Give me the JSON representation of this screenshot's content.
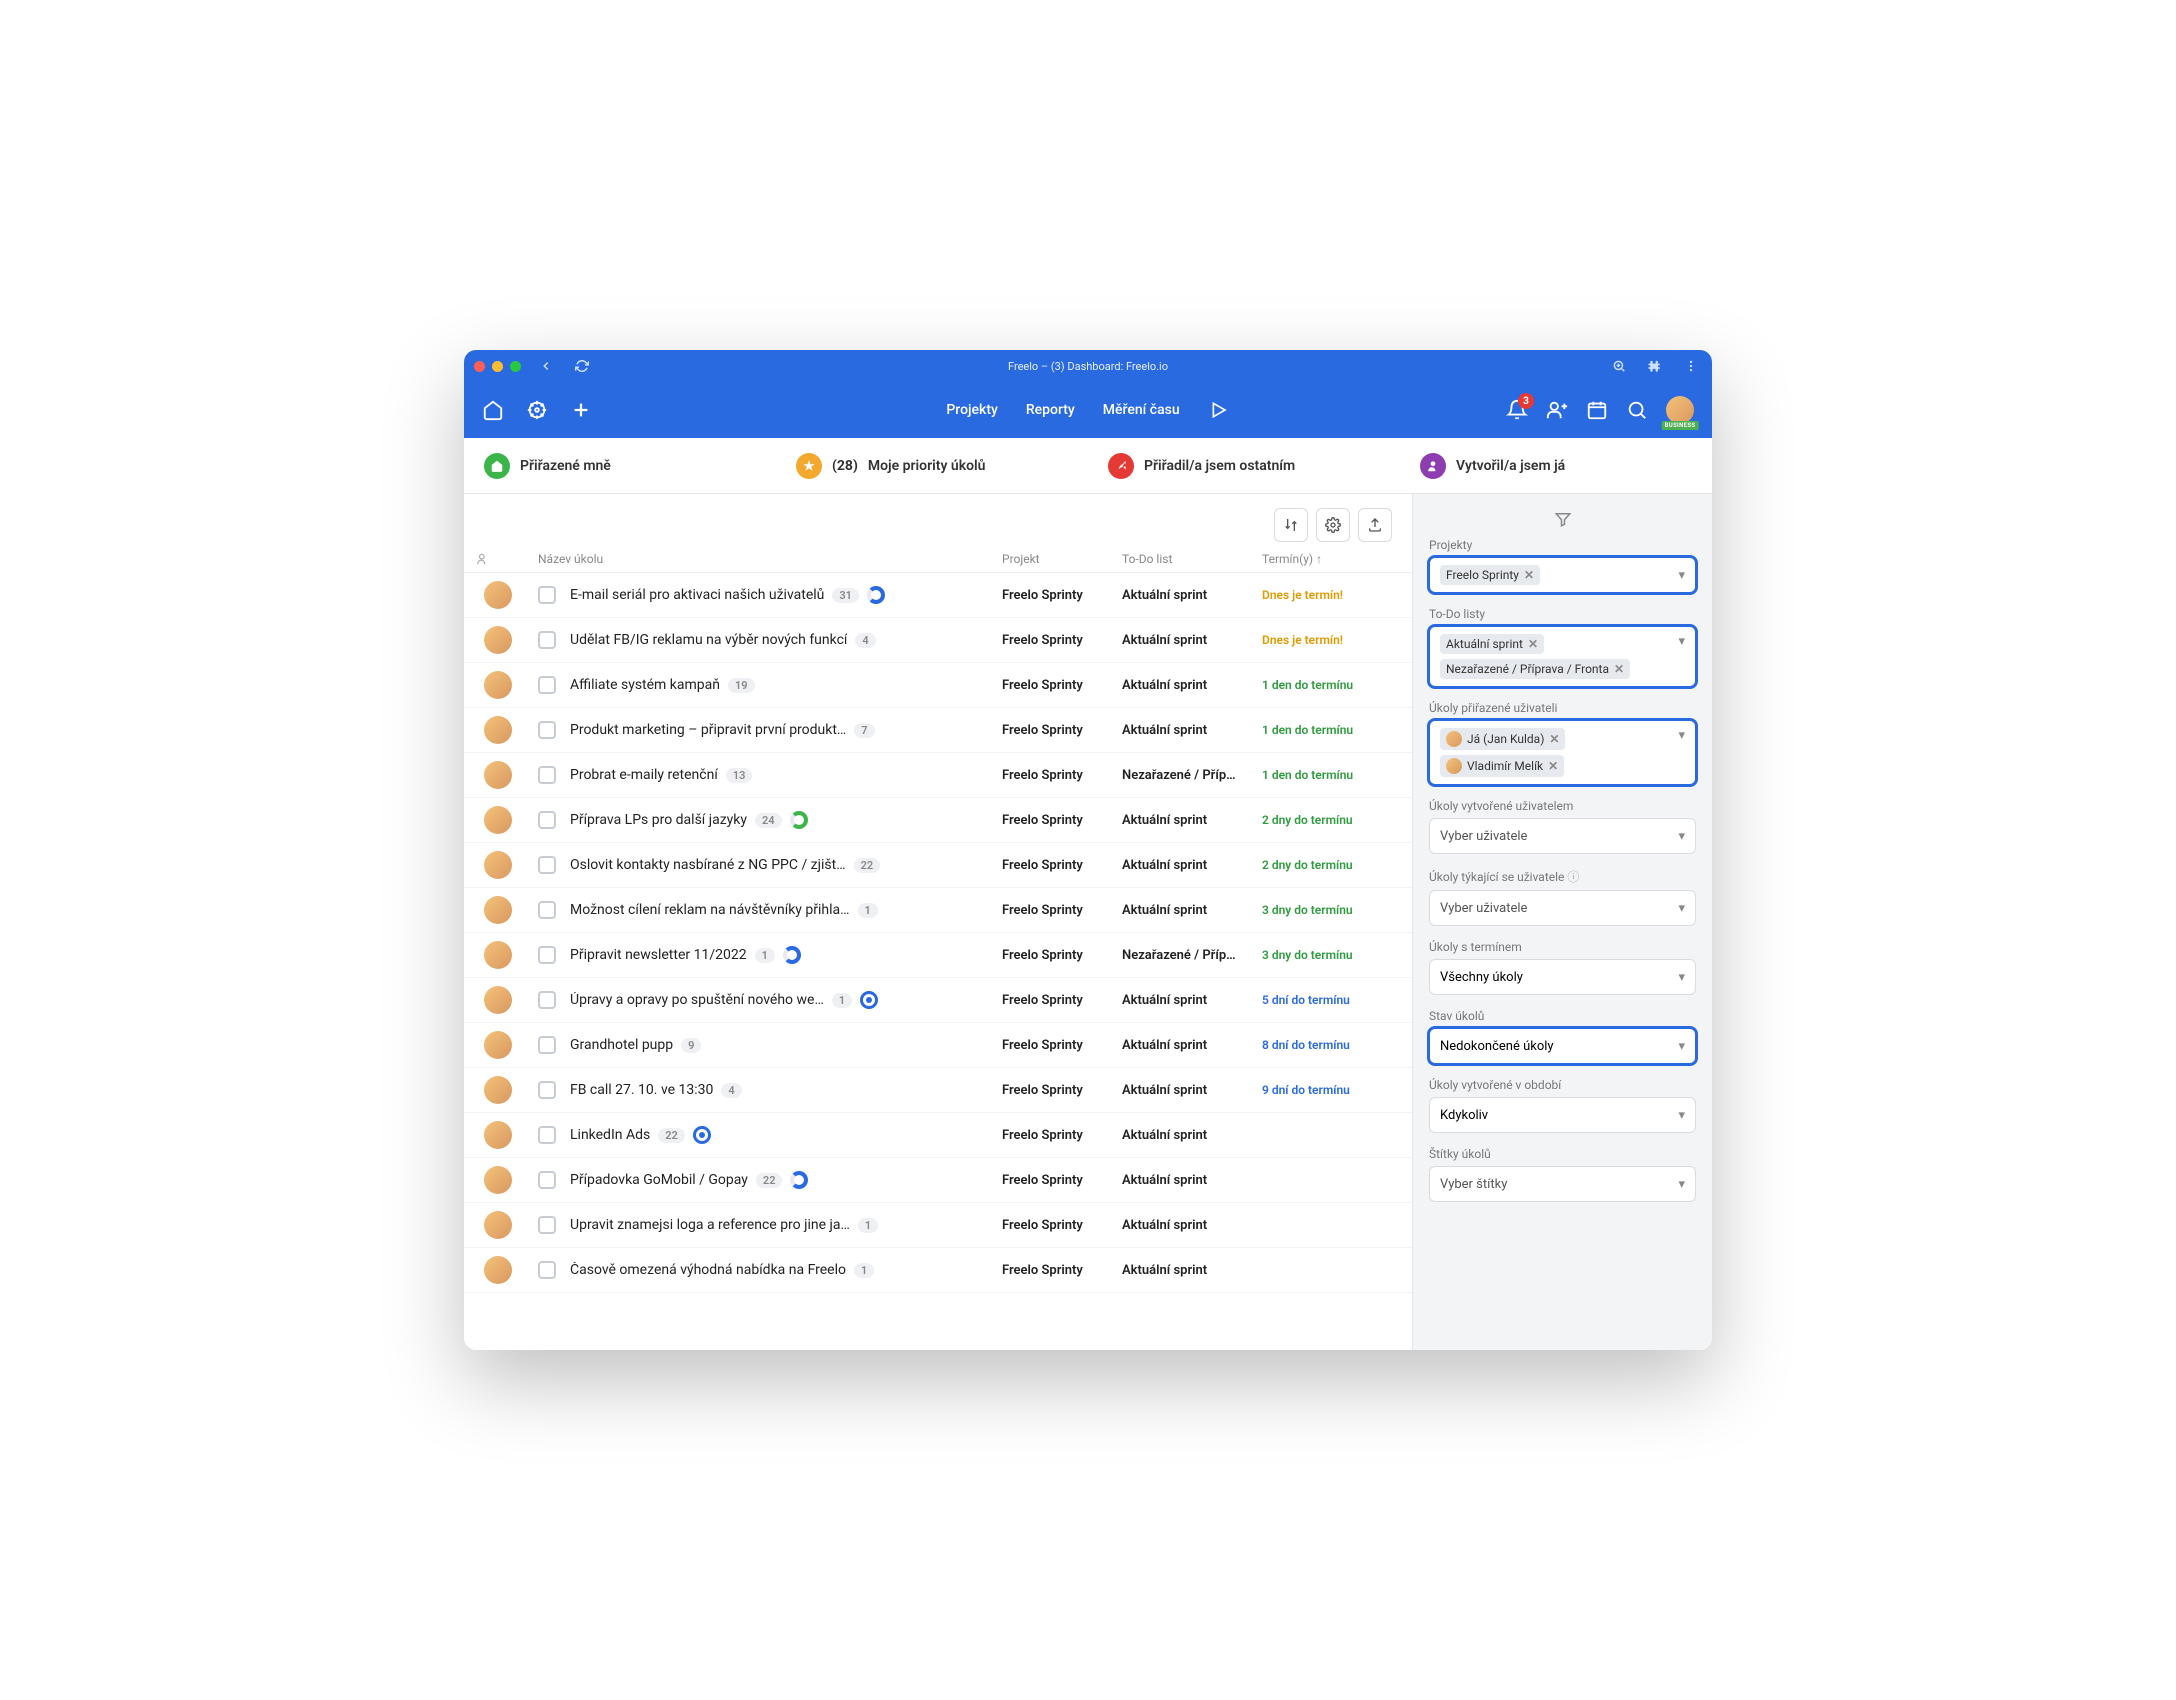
{
  "window_title": "Freelo – (3) Dashboard: Freelo.io",
  "notif_count": "3",
  "avatar_badge": "BUSINESS",
  "nav": {
    "projekty": "Projekty",
    "reporty": "Reporty",
    "mereni": "Měření času"
  },
  "tabs": {
    "assigned": "Přiřazené mně",
    "priority_count": "(28)",
    "priority": "Moje priority úkolů",
    "delegated": "Přiřadil/a jsem ostatním",
    "created": "Vytvořil/a jsem já"
  },
  "columns": {
    "name": "Název úkolu",
    "project": "Projekt",
    "list": "To-Do list",
    "due": "Termín(y) ↑"
  },
  "rows": [
    {
      "title": "E-mail seriál pro aktivaci našich uživatelů",
      "count": "31",
      "ring": "#2a6ae0",
      "project": "Freelo Sprinty",
      "list": "Aktuální sprint",
      "due": "Dnes je termín!",
      "dueColor": "#e09a00"
    },
    {
      "title": "Udělat FB/IG reklamu na výběr nových funkcí",
      "count": "4",
      "project": "Freelo Sprinty",
      "list": "Aktuální sprint",
      "due": "Dnes je termín!",
      "dueColor": "#e09a00"
    },
    {
      "title": "Affiliate systém kampaň",
      "count": "19",
      "project": "Freelo Sprinty",
      "list": "Aktuální sprint",
      "due": "1 den do termínu",
      "dueColor": "#2e9b3e"
    },
    {
      "title": "Produkt marketing – připravit první produkt…",
      "count": "7",
      "project": "Freelo Sprinty",
      "list": "Aktuální sprint",
      "due": "1 den do termínu",
      "dueColor": "#2e9b3e"
    },
    {
      "title": "Probrat e-maily retenční",
      "count": "13",
      "project": "Freelo Sprinty",
      "list": "Nezařazené / Příp…",
      "due": "1 den do termínu",
      "dueColor": "#2e9b3e"
    },
    {
      "title": "Příprava LPs pro další jazyky",
      "count": "24",
      "ring": "#3bb54a",
      "project": "Freelo Sprinty",
      "list": "Aktuální sprint",
      "due": "2 dny do termínu",
      "dueColor": "#2e9b3e"
    },
    {
      "title": "Oslovit kontakty nasbírané z NG PPC / zjišt…",
      "count": "22",
      "project": "Freelo Sprinty",
      "list": "Aktuální sprint",
      "due": "2 dny do termínu",
      "dueColor": "#2e9b3e"
    },
    {
      "title": "Možnost cílení reklam na návštěvníky přihla…",
      "count": "1",
      "project": "Freelo Sprinty",
      "list": "Aktuální sprint",
      "due": "3 dny do termínu",
      "dueColor": "#2e9b3e"
    },
    {
      "title": "Připravit newsletter 11/2022",
      "count": "1",
      "ring": "#2a6ae0",
      "project": "Freelo Sprinty",
      "list": "Nezařazené / Příp…",
      "due": "3 dny do termínu",
      "dueColor": "#2e9b3e"
    },
    {
      "title": "Úpravy a opravy po spuštění nového we…",
      "count": "1",
      "ring": "#2a6ae0",
      "ringStyle": "target",
      "project": "Freelo Sprinty",
      "list": "Aktuální sprint",
      "due": "5 dní do termínu",
      "dueColor": "#2a6ae0"
    },
    {
      "title": "Grandhotel pupp",
      "count": "9",
      "project": "Freelo Sprinty",
      "list": "Aktuální sprint",
      "due": "8 dní do termínu",
      "dueColor": "#2a6ae0"
    },
    {
      "title": "FB call 27. 10. ve 13:30",
      "count": "4",
      "project": "Freelo Sprinty",
      "list": "Aktuální sprint",
      "due": "9 dní do termínu",
      "dueColor": "#2a6ae0"
    },
    {
      "title": "LinkedIn Ads",
      "count": "22",
      "ring": "#2a6ae0",
      "ringStyle": "target",
      "project": "Freelo Sprinty",
      "list": "Aktuální sprint",
      "due": "",
      "dueColor": ""
    },
    {
      "title": "Případovka GoMobil / Gopay",
      "count": "22",
      "ring": "#2a6ae0",
      "project": "Freelo Sprinty",
      "list": "Aktuální sprint",
      "due": "",
      "dueColor": ""
    },
    {
      "title": "Upravit znamejsi loga a reference pro jine ja…",
      "count": "1",
      "project": "Freelo Sprinty",
      "list": "Aktuální sprint",
      "due": "",
      "dueColor": ""
    },
    {
      "title": "Časově omezená výhodná nabídka na Freelo",
      "count": "1",
      "project": "Freelo Sprinty",
      "list": "Aktuální sprint",
      "due": "",
      "dueColor": ""
    }
  ],
  "filters": {
    "projects_label": "Projekty",
    "projects": [
      "Freelo Sprinty"
    ],
    "lists_label": "To-Do listy",
    "lists": [
      "Aktuální sprint",
      "Nezařazené / Příprava / Fronta"
    ],
    "assigned_label": "Úkoly přiřazené uživateli",
    "assigned": [
      "Já (Jan Kulda)",
      "Vladimír Melík"
    ],
    "created_by_label": "Úkoly vytvořené uživatelem",
    "created_by_placeholder": "Vyber uživatele",
    "related_label": "Úkoly týkající se uživatele",
    "related_placeholder": "Vyber uživatele",
    "deadline_label": "Úkoly s termínem",
    "deadline_value": "Všechny úkoly",
    "status_label": "Stav úkolů",
    "status_value": "Nedokončené úkoly",
    "period_label": "Úkoly vytvořené v období",
    "period_value": "Kdykoliv",
    "tags_label": "Štítky úkolů",
    "tags_placeholder": "Vyber štítky"
  }
}
